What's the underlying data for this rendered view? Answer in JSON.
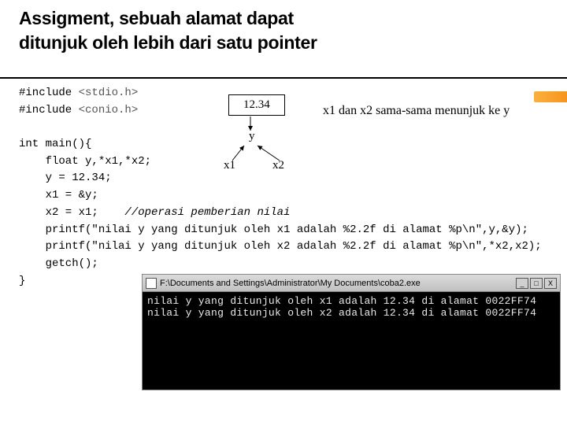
{
  "title_line1": "Assigment, sebuah alamat dapat",
  "title_line2": "ditunjuk oleh lebih dari satu pointer",
  "code": {
    "l1a": "#include ",
    "l1b": "<stdio.h>",
    "l2a": "#include ",
    "l2b": "<conio.h>",
    "blank": "",
    "l3": "int main(){",
    "l4": "    float y,*x1,*x2;",
    "l5": "    y = 12.34;",
    "l6": "    x1 = &y;",
    "l7a": "    x2 = x1;    ",
    "l7b": "//operasi pemberian nilai",
    "l8": "    printf(\"nilai y yang ditunjuk oleh x1 adalah %2.2f di alamat %p\\n\",y,&y);",
    "l9": "    printf(\"nilai y yang ditunjuk oleh x2 adalah %2.2f di alamat %p\\n\",*x2,x2);",
    "l10": "    getch();",
    "l11": "}"
  },
  "diagram": {
    "value": "12.34",
    "label_y": "y",
    "label_x1": "x1",
    "label_x2": "x2",
    "desc": "x1 dan x2 sama-sama menunjuk ke y"
  },
  "terminal": {
    "path": "F:\\Documents and Settings\\Administrator\\My Documents\\coba2.exe",
    "l1": "nilai y yang ditunjuk oleh x1 adalah 12.34 di alamat 0022FF74",
    "l2": "nilai y yang ditunjuk oleh x2 adalah 12.34 di alamat 0022FF74",
    "min": "_",
    "max": "□",
    "close": "X"
  }
}
